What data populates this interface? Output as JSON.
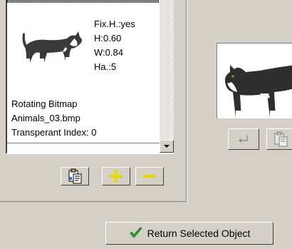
{
  "object": {
    "props": [
      "Fix.H.:yes",
      "H:0.60",
      "W:0.84",
      "Ha.:5"
    ],
    "desc": [
      "Rotating Bitmap",
      "Animals_03.bmp",
      "Transperant Index: 0"
    ]
  },
  "icons": {
    "copy": "copy-clipboard-icon",
    "plus": "plus-icon",
    "minus": "minus-icon",
    "enter": "enter-arrow-icon",
    "check": "check-icon",
    "cat": "cat-image"
  },
  "colors": {
    "plus_minus": "#e8d800",
    "check": "#2ca02c"
  },
  "footer": {
    "ok_label": "Return Selected Object"
  }
}
